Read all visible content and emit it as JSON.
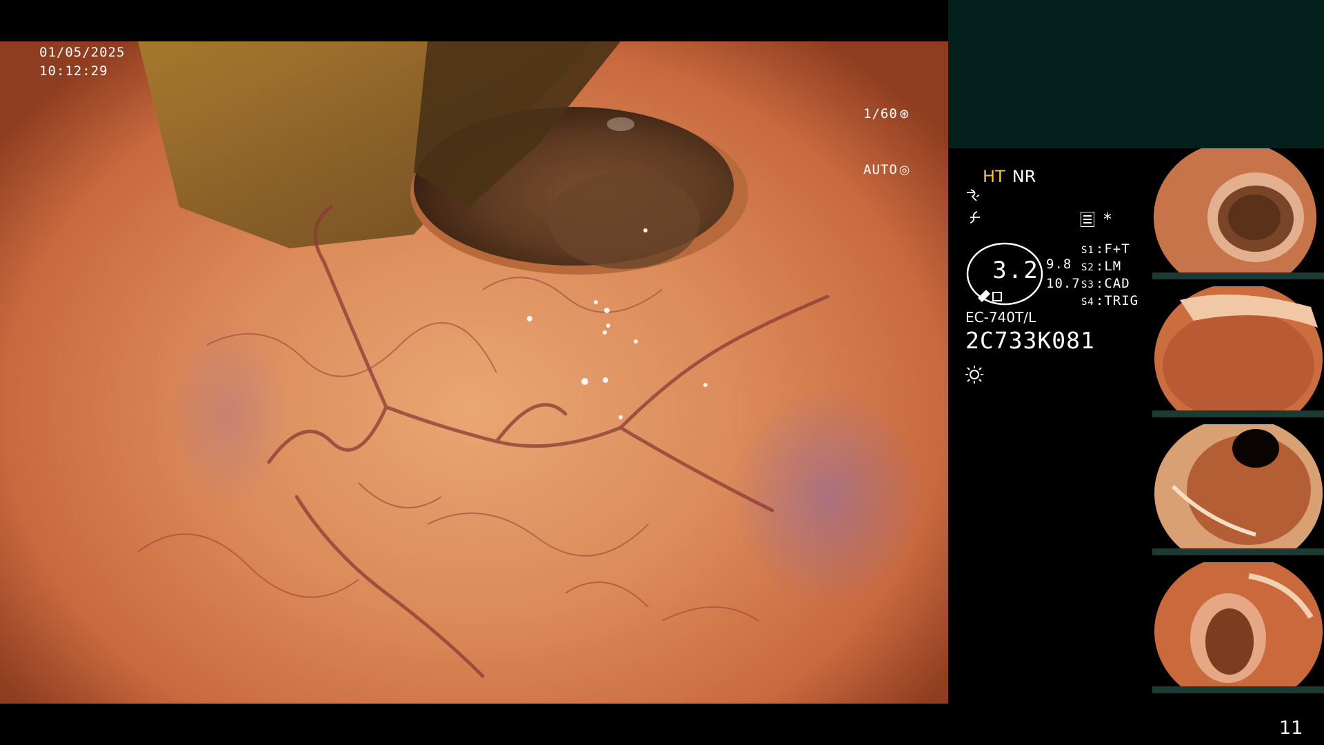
{
  "overlay": {
    "date": "01/05/2025",
    "time": "10:12:29",
    "shutter": "1/60",
    "exposure_mode": "AUTO"
  },
  "side_panel": {
    "mode_ht": "HT",
    "mode_nr": "NR",
    "ratio_value": "3.2",
    "num_a": "9.8",
    "num_b": "10.7",
    "slots": [
      {
        "key": "S1",
        "value": "F+T"
      },
      {
        "key": "S2",
        "value": "LM"
      },
      {
        "key": "S3",
        "value": "CAD"
      },
      {
        "key": "S4",
        "value": "TRIG"
      }
    ],
    "scope_model": "EC-740T/L",
    "serial": "2C733K081"
  },
  "page_number": "11",
  "colors": {
    "mucosa": "#d98a5c",
    "top_panel": "#04201c",
    "highlight_label": "#f5c829"
  },
  "icons": [
    "shutter-icon",
    "auto-iris-icon",
    "settings-icon",
    "asterisk-icon",
    "brightness-icon"
  ]
}
